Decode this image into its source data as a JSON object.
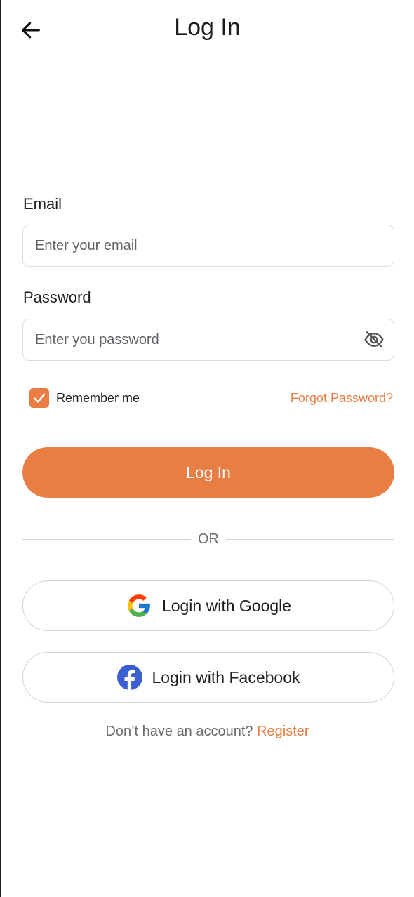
{
  "header": {
    "title": "Log In",
    "back_icon": "arrow-left-icon"
  },
  "form": {
    "email_label": "Email",
    "email_value": "",
    "email_placeholder": "Enter your email",
    "password_label": "Password",
    "password_value": "",
    "password_placeholder": "Enter you password",
    "password_toggle_icon": "eye-off-icon",
    "remember_label": "Remember me",
    "remember_checked": true,
    "forgot_label": "Forgot Password?"
  },
  "actions": {
    "login_label": "Log In",
    "divider_label": "OR",
    "google_label": "Login with Google",
    "google_icon": "google-icon",
    "facebook_label": "Login with Facebook",
    "facebook_icon": "facebook-icon"
  },
  "footer": {
    "prompt": "Don’t have an account?",
    "register_label": "Register"
  },
  "colors": {
    "accent": "#e97e44",
    "border": "#dcdcdc",
    "muted_text": "#6b6b6b",
    "facebook_blue": "#3b5fd0"
  }
}
